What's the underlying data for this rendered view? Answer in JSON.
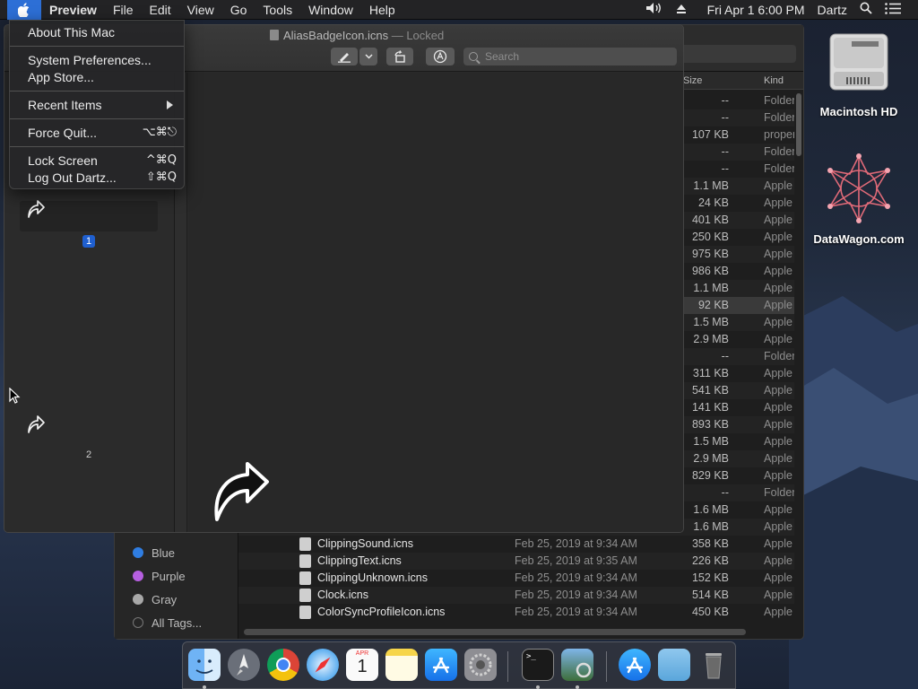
{
  "menubar": {
    "app_name": "Preview",
    "items": [
      "File",
      "Edit",
      "View",
      "Go",
      "Tools",
      "Window",
      "Help"
    ],
    "clock": "Fri Apr 1  6:00 PM",
    "user": "Dartz",
    "icons": [
      "volume-icon",
      "eject-icon",
      "spotlight-icon",
      "notification-center-icon"
    ]
  },
  "apple_menu": {
    "about": "About This Mac",
    "system_prefs": "System Preferences...",
    "app_store": "App Store...",
    "recent_items": "Recent Items",
    "force_quit": "Force Quit...",
    "force_quit_shortcut": "⌥⌘⎋",
    "lock_screen": "Lock Screen",
    "lock_screen_shortcut": "^⌘Q",
    "log_out": "Log Out Dartz...",
    "log_out_shortcut": "⇧⌘Q"
  },
  "preview_window": {
    "title": "AliasBadgeIcon.icns",
    "status": "— Locked",
    "search_placeholder": "Search",
    "pages": [
      {
        "number": "1",
        "selected": true
      },
      {
        "number": "2",
        "selected": false
      }
    ]
  },
  "finder": {
    "columns": {
      "size": "Size",
      "kind": "Kind"
    },
    "hidden_rows": [
      {
        "size": "--",
        "kind": "Folder"
      },
      {
        "size": "--",
        "kind": "Folder"
      },
      {
        "size": "107 KB",
        "kind": "property"
      },
      {
        "size": "--",
        "kind": "Folder"
      },
      {
        "size": "--",
        "kind": "Folder"
      },
      {
        "size": "1.1 MB",
        "kind": "Apple"
      },
      {
        "size": "24 KB",
        "kind": "Apple"
      },
      {
        "size": "401 KB",
        "kind": "Apple"
      },
      {
        "size": "250 KB",
        "kind": "Apple"
      },
      {
        "size": "975 KB",
        "kind": "Apple"
      },
      {
        "size": "986 KB",
        "kind": "Apple"
      },
      {
        "size": "1.1 MB",
        "kind": "Apple"
      },
      {
        "size": "92 KB",
        "kind": "Apple"
      },
      {
        "size": "1.5 MB",
        "kind": "Apple"
      },
      {
        "size": "2.9 MB",
        "kind": "Apple"
      },
      {
        "size": "--",
        "kind": "Folder"
      },
      {
        "size": "311 KB",
        "kind": "Apple"
      },
      {
        "size": "541 KB",
        "kind": "Apple"
      },
      {
        "size": "141 KB",
        "kind": "Apple"
      },
      {
        "size": "893 KB",
        "kind": "Apple"
      },
      {
        "size": "1.5 MB",
        "kind": "Apple"
      },
      {
        "size": "2.9 MB",
        "kind": "Apple"
      },
      {
        "size": "829 KB",
        "kind": "Apple"
      },
      {
        "size": "--",
        "kind": "Folder"
      },
      {
        "size": "1.6 MB",
        "kind": "Apple"
      },
      {
        "size": "1.6 MB",
        "kind": "Apple"
      }
    ],
    "visible_rows": [
      {
        "name": "ClippingSound.icns",
        "date": "Feb 25, 2019 at 9:34 AM",
        "size": "358 KB",
        "kind": "Apple"
      },
      {
        "name": "ClippingText.icns",
        "date": "Feb 25, 2019 at 9:35 AM",
        "size": "226 KB",
        "kind": "Apple"
      },
      {
        "name": "ClippingUnknown.icns",
        "date": "Feb 25, 2019 at 9:34 AM",
        "size": "152 KB",
        "kind": "Apple"
      },
      {
        "name": "Clock.icns",
        "date": "Feb 25, 2019 at 9:34 AM",
        "size": "514 KB",
        "kind": "Apple"
      },
      {
        "name": "ColorSyncProfileIcon.icns",
        "date": "Feb 25, 2019 at 9:34 AM",
        "size": "450 KB",
        "kind": "Apple"
      }
    ],
    "tags": [
      {
        "label": "Blue",
        "color": "#2f7de1"
      },
      {
        "label": "Purple",
        "color": "#b65fe0"
      },
      {
        "label": "Gray",
        "color": "#a8a8a8"
      },
      {
        "label": "All Tags...",
        "color": "#555555"
      }
    ]
  },
  "desktop": {
    "icons": [
      {
        "label": "Macintosh HD",
        "icon": "hard-drive-icon"
      },
      {
        "label": "DataWagon.com",
        "icon": "datawagon-logo-icon"
      }
    ]
  },
  "dock": {
    "apps": [
      "Finder",
      "Launchpad",
      "Chrome",
      "Safari",
      "Calendar",
      "Notes",
      "App Store",
      "System Preferences",
      "Terminal",
      "Preview",
      "App Store Downloads",
      "Folder",
      "Trash"
    ],
    "calendar": {
      "month": "APR",
      "day": "1"
    }
  }
}
